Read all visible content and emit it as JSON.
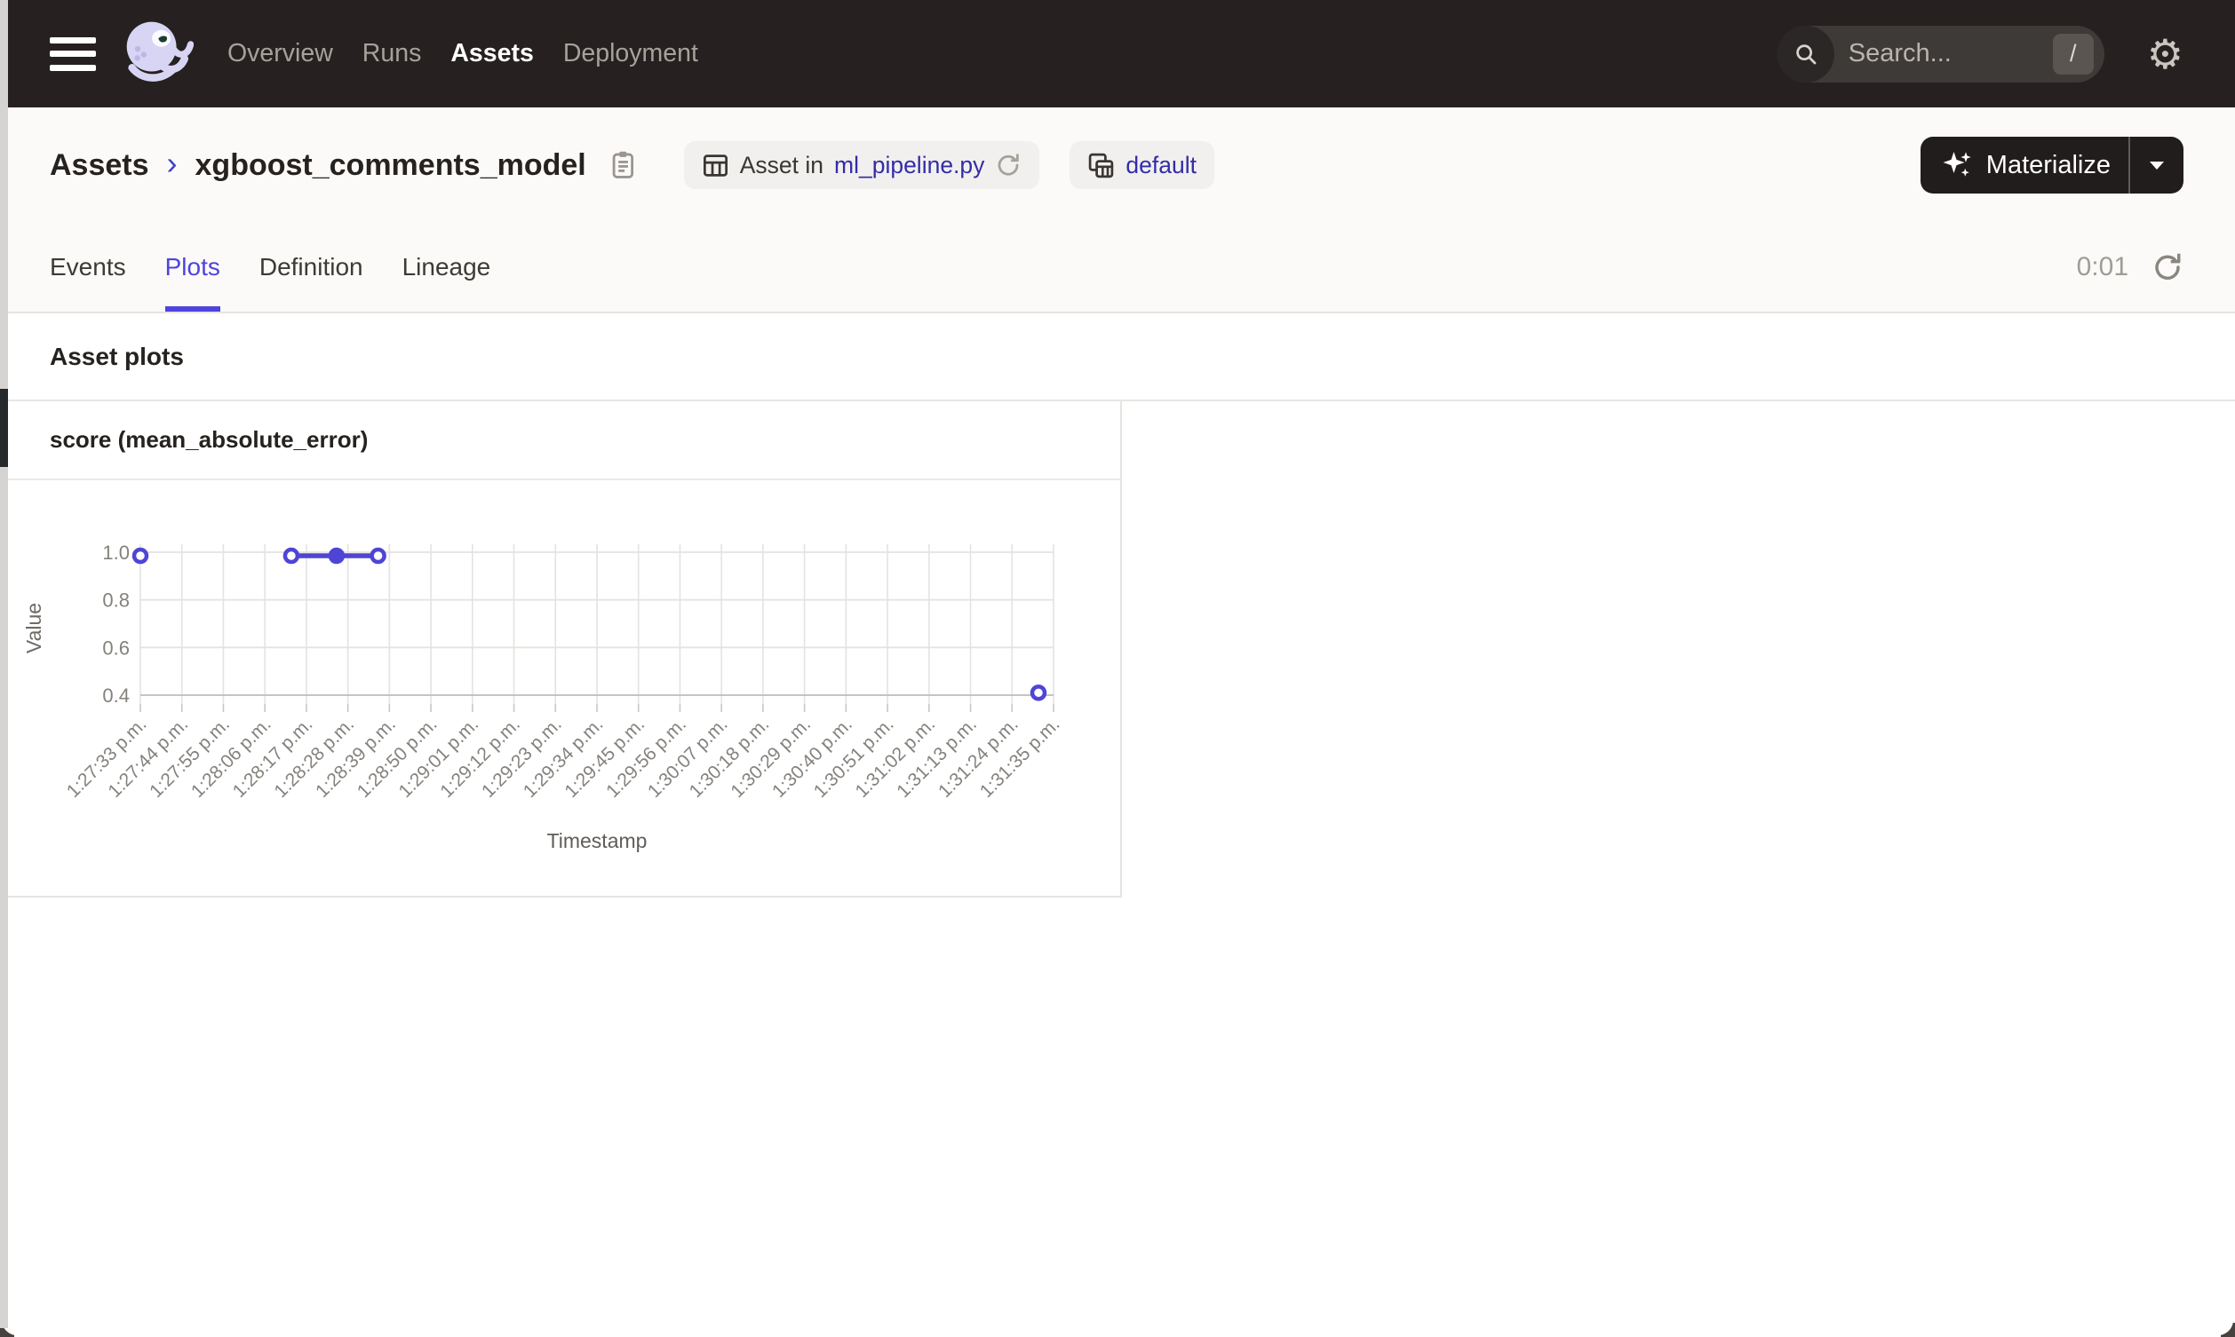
{
  "nav": {
    "items": [
      {
        "label": "Overview",
        "active": false
      },
      {
        "label": "Runs",
        "active": false
      },
      {
        "label": "Assets",
        "active": true
      },
      {
        "label": "Deployment",
        "active": false
      }
    ],
    "search": {
      "placeholder": "Search...",
      "shortcut": "/"
    }
  },
  "breadcrumb": {
    "root": "Assets",
    "separator": "›",
    "current": "xgboost_comments_model"
  },
  "badges": {
    "asset_in": {
      "prefix": "Asset in",
      "link": "ml_pipeline.py"
    },
    "group": {
      "link": "default"
    }
  },
  "materialize": {
    "label": "Materialize"
  },
  "tabs": {
    "items": [
      {
        "label": "Events",
        "active": false
      },
      {
        "label": "Plots",
        "active": true
      },
      {
        "label": "Definition",
        "active": false
      },
      {
        "label": "Lineage",
        "active": false
      }
    ],
    "timer": "0:01"
  },
  "section": {
    "title": "Asset plots"
  },
  "chart_card": {
    "title": "score (mean_absolute_error)"
  },
  "chart_data": {
    "type": "line",
    "title": "score (mean_absolute_error)",
    "xlabel": "Timestamp",
    "ylabel": "Value",
    "grid": true,
    "y_ticks": [
      0.4,
      0.6,
      0.8,
      1.0
    ],
    "ylim": [
      0.33,
      1.03
    ],
    "x_tick_interval_seconds": 11,
    "x_tick_labels": [
      "1:27:33 p.m.",
      "1:27:44 p.m.",
      "1:27:55 p.m.",
      "1:28:06 p.m.",
      "1:28:17 p.m.",
      "1:28:28 p.m.",
      "1:28:39 p.m.",
      "1:28:50 p.m.",
      "1:29:01 p.m.",
      "1:29:12 p.m.",
      "1:29:23 p.m.",
      "1:29:34 p.m.",
      "1:29:45 p.m.",
      "1:29:56 p.m.",
      "1:30:07 p.m.",
      "1:30:18 p.m.",
      "1:30:29 p.m.",
      "1:30:40 p.m.",
      "1:30:51 p.m.",
      "1:31:02 p.m.",
      "1:31:13 p.m.",
      "1:31:24 p.m.",
      "1:31:35 p.m."
    ],
    "series": [
      {
        "name": "score (mean_absolute_error)",
        "color": "#4E45D5",
        "points": [
          {
            "t": "1:27:33 p.m.",
            "value": 0.985,
            "marker": "open"
          },
          {
            "t": "1:28:13 p.m.",
            "value": 0.985,
            "marker": "open"
          },
          {
            "t": "1:28:25 p.m.",
            "value": 0.985,
            "marker": "filled"
          },
          {
            "t": "1:28:36 p.m.",
            "value": 0.985,
            "marker": "open"
          },
          {
            "t": "1:31:31 p.m.",
            "value": 0.41,
            "marker": "open"
          }
        ],
        "connected_segments": [
          [
            1,
            2,
            3
          ]
        ]
      }
    ]
  },
  "colors": {
    "nav_bg": "#262120",
    "accent": "#4F43DD",
    "link": "#332DA8",
    "chart_line": "#4E45D5",
    "grid_line": "#E5E3E1",
    "axis_text": "#85827D",
    "materialize_bg": "#211D1C"
  }
}
